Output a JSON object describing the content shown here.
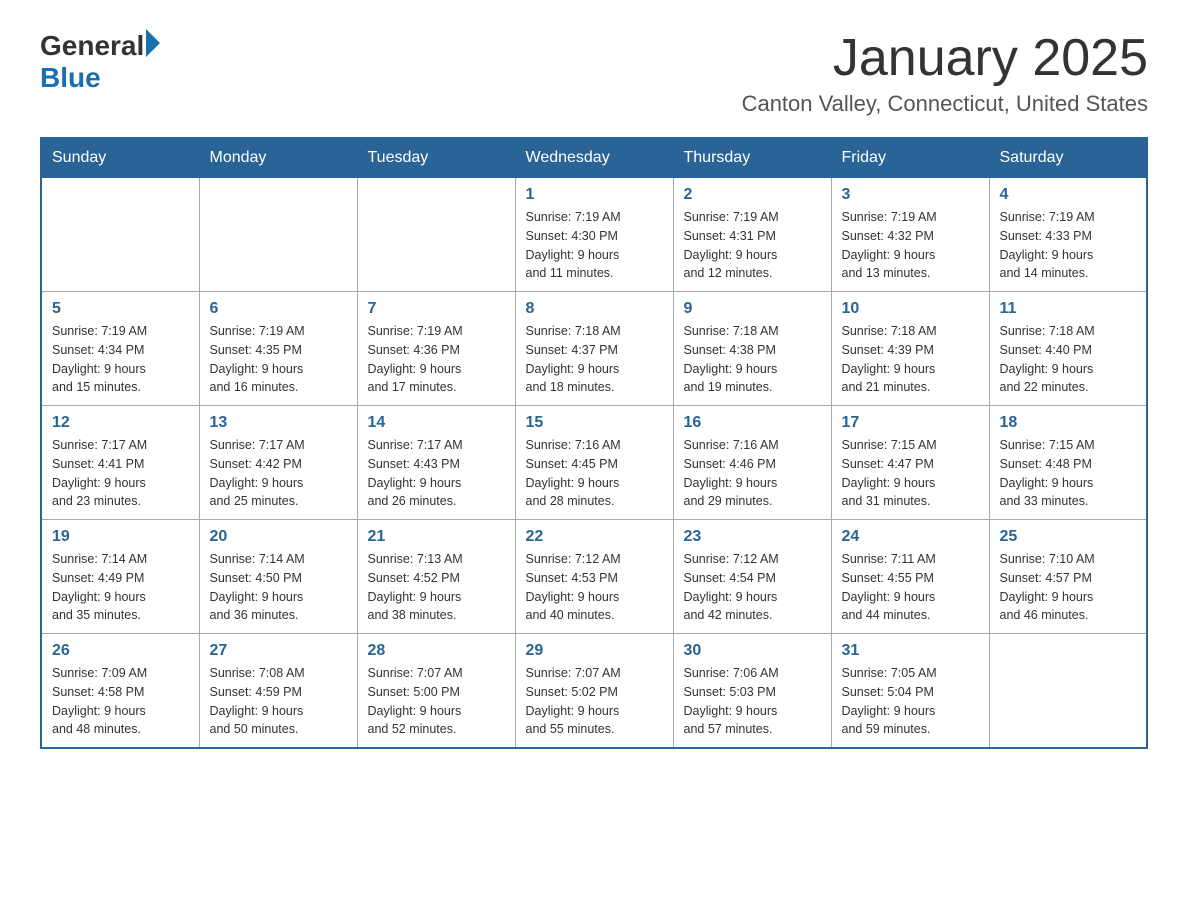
{
  "header": {
    "logo_general": "General",
    "logo_blue": "Blue",
    "title": "January 2025",
    "subtitle": "Canton Valley, Connecticut, United States"
  },
  "days_of_week": [
    "Sunday",
    "Monday",
    "Tuesday",
    "Wednesday",
    "Thursday",
    "Friday",
    "Saturday"
  ],
  "weeks": [
    [
      {
        "day": "",
        "info": ""
      },
      {
        "day": "",
        "info": ""
      },
      {
        "day": "",
        "info": ""
      },
      {
        "day": "1",
        "info": "Sunrise: 7:19 AM\nSunset: 4:30 PM\nDaylight: 9 hours\nand 11 minutes."
      },
      {
        "day": "2",
        "info": "Sunrise: 7:19 AM\nSunset: 4:31 PM\nDaylight: 9 hours\nand 12 minutes."
      },
      {
        "day": "3",
        "info": "Sunrise: 7:19 AM\nSunset: 4:32 PM\nDaylight: 9 hours\nand 13 minutes."
      },
      {
        "day": "4",
        "info": "Sunrise: 7:19 AM\nSunset: 4:33 PM\nDaylight: 9 hours\nand 14 minutes."
      }
    ],
    [
      {
        "day": "5",
        "info": "Sunrise: 7:19 AM\nSunset: 4:34 PM\nDaylight: 9 hours\nand 15 minutes."
      },
      {
        "day": "6",
        "info": "Sunrise: 7:19 AM\nSunset: 4:35 PM\nDaylight: 9 hours\nand 16 minutes."
      },
      {
        "day": "7",
        "info": "Sunrise: 7:19 AM\nSunset: 4:36 PM\nDaylight: 9 hours\nand 17 minutes."
      },
      {
        "day": "8",
        "info": "Sunrise: 7:18 AM\nSunset: 4:37 PM\nDaylight: 9 hours\nand 18 minutes."
      },
      {
        "day": "9",
        "info": "Sunrise: 7:18 AM\nSunset: 4:38 PM\nDaylight: 9 hours\nand 19 minutes."
      },
      {
        "day": "10",
        "info": "Sunrise: 7:18 AM\nSunset: 4:39 PM\nDaylight: 9 hours\nand 21 minutes."
      },
      {
        "day": "11",
        "info": "Sunrise: 7:18 AM\nSunset: 4:40 PM\nDaylight: 9 hours\nand 22 minutes."
      }
    ],
    [
      {
        "day": "12",
        "info": "Sunrise: 7:17 AM\nSunset: 4:41 PM\nDaylight: 9 hours\nand 23 minutes."
      },
      {
        "day": "13",
        "info": "Sunrise: 7:17 AM\nSunset: 4:42 PM\nDaylight: 9 hours\nand 25 minutes."
      },
      {
        "day": "14",
        "info": "Sunrise: 7:17 AM\nSunset: 4:43 PM\nDaylight: 9 hours\nand 26 minutes."
      },
      {
        "day": "15",
        "info": "Sunrise: 7:16 AM\nSunset: 4:45 PM\nDaylight: 9 hours\nand 28 minutes."
      },
      {
        "day": "16",
        "info": "Sunrise: 7:16 AM\nSunset: 4:46 PM\nDaylight: 9 hours\nand 29 minutes."
      },
      {
        "day": "17",
        "info": "Sunrise: 7:15 AM\nSunset: 4:47 PM\nDaylight: 9 hours\nand 31 minutes."
      },
      {
        "day": "18",
        "info": "Sunrise: 7:15 AM\nSunset: 4:48 PM\nDaylight: 9 hours\nand 33 minutes."
      }
    ],
    [
      {
        "day": "19",
        "info": "Sunrise: 7:14 AM\nSunset: 4:49 PM\nDaylight: 9 hours\nand 35 minutes."
      },
      {
        "day": "20",
        "info": "Sunrise: 7:14 AM\nSunset: 4:50 PM\nDaylight: 9 hours\nand 36 minutes."
      },
      {
        "day": "21",
        "info": "Sunrise: 7:13 AM\nSunset: 4:52 PM\nDaylight: 9 hours\nand 38 minutes."
      },
      {
        "day": "22",
        "info": "Sunrise: 7:12 AM\nSunset: 4:53 PM\nDaylight: 9 hours\nand 40 minutes."
      },
      {
        "day": "23",
        "info": "Sunrise: 7:12 AM\nSunset: 4:54 PM\nDaylight: 9 hours\nand 42 minutes."
      },
      {
        "day": "24",
        "info": "Sunrise: 7:11 AM\nSunset: 4:55 PM\nDaylight: 9 hours\nand 44 minutes."
      },
      {
        "day": "25",
        "info": "Sunrise: 7:10 AM\nSunset: 4:57 PM\nDaylight: 9 hours\nand 46 minutes."
      }
    ],
    [
      {
        "day": "26",
        "info": "Sunrise: 7:09 AM\nSunset: 4:58 PM\nDaylight: 9 hours\nand 48 minutes."
      },
      {
        "day": "27",
        "info": "Sunrise: 7:08 AM\nSunset: 4:59 PM\nDaylight: 9 hours\nand 50 minutes."
      },
      {
        "day": "28",
        "info": "Sunrise: 7:07 AM\nSunset: 5:00 PM\nDaylight: 9 hours\nand 52 minutes."
      },
      {
        "day": "29",
        "info": "Sunrise: 7:07 AM\nSunset: 5:02 PM\nDaylight: 9 hours\nand 55 minutes."
      },
      {
        "day": "30",
        "info": "Sunrise: 7:06 AM\nSunset: 5:03 PM\nDaylight: 9 hours\nand 57 minutes."
      },
      {
        "day": "31",
        "info": "Sunrise: 7:05 AM\nSunset: 5:04 PM\nDaylight: 9 hours\nand 59 minutes."
      },
      {
        "day": "",
        "info": ""
      }
    ]
  ]
}
